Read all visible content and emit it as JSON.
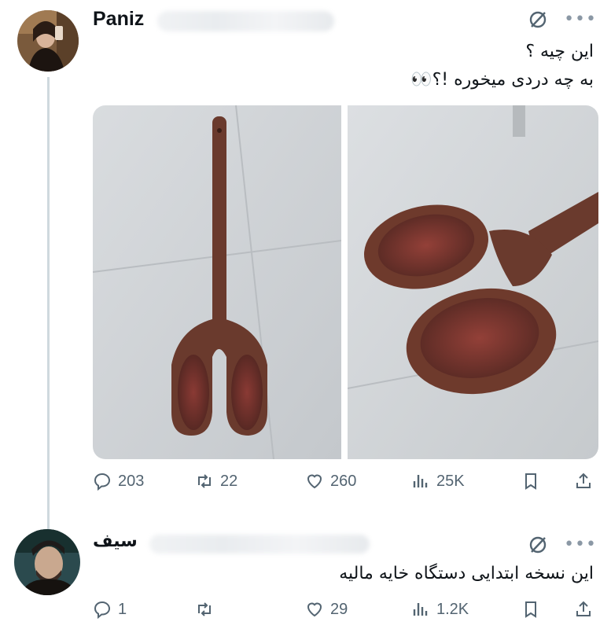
{
  "tweet": {
    "author": "Paniz",
    "line1": "این چیه ؟",
    "line2": "به چه دردی میخوره !؟👀",
    "stats": {
      "replies": "203",
      "retweets": "22",
      "likes": "260",
      "views": "25K"
    }
  },
  "reply": {
    "author": "سیف",
    "text": "این نسخه ابتدایی دستگاه خایه مالیه",
    "stats": {
      "replies": "1",
      "retweets": "",
      "likes": "29",
      "views": "1.2K"
    }
  },
  "icons": [
    "grok-icon",
    "more-icon",
    "reply-icon",
    "retweet-icon",
    "like-icon",
    "views-icon",
    "bookmark-icon",
    "share-icon"
  ],
  "colors": {
    "text": "#0f1419",
    "muted": "#536471",
    "thread_line": "#cfd9de",
    "wood": "#6e3a2c"
  }
}
